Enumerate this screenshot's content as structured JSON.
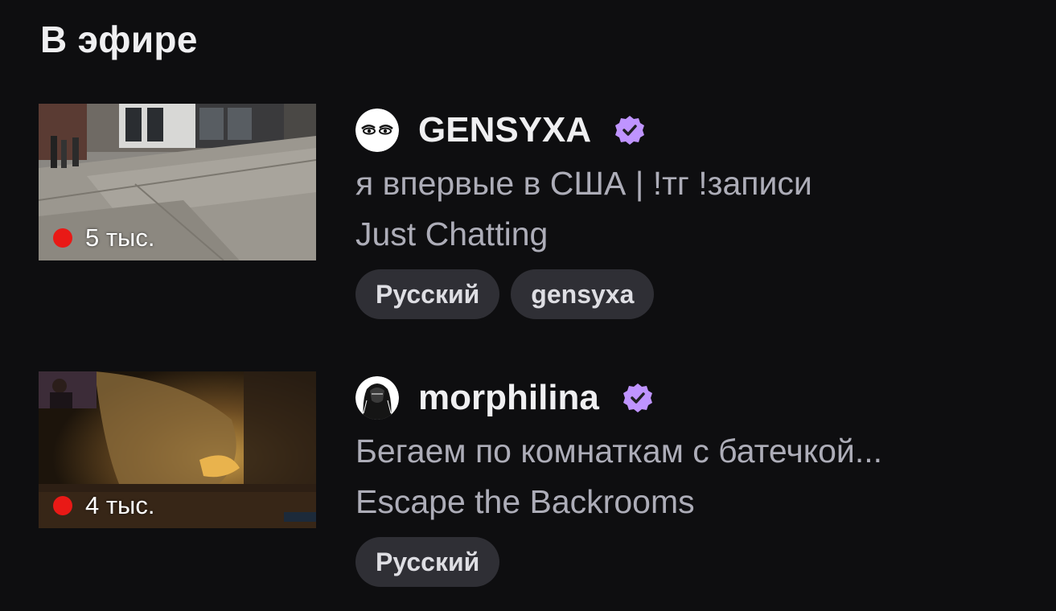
{
  "section": {
    "title": "В эфире"
  },
  "streams": [
    {
      "channel": "GENSYXA",
      "avatar_icon": "eyes-avatar-icon",
      "verified_icon": "verified-badge-icon",
      "title": "я впервые в США | !тг !записи",
      "category": "Just Chatting",
      "viewers": "5 тыс.",
      "tags": [
        "Русский",
        "gensyxa"
      ]
    },
    {
      "channel": "morphilina",
      "avatar_icon": "dark-figure-avatar-icon",
      "verified_icon": "verified-badge-icon",
      "title": "Бегаем по комнаткам с батечкой...",
      "category": "Escape the Backrooms",
      "viewers": "4 тыс.",
      "tags": [
        "Русский"
      ]
    }
  ],
  "colors": {
    "background": "#0e0e10",
    "text_primary": "#efeff1",
    "text_secondary": "#adadb8",
    "tag_bg": "#2f2f35",
    "live_red": "#e91916",
    "verified_purple": "#bf94ff"
  }
}
